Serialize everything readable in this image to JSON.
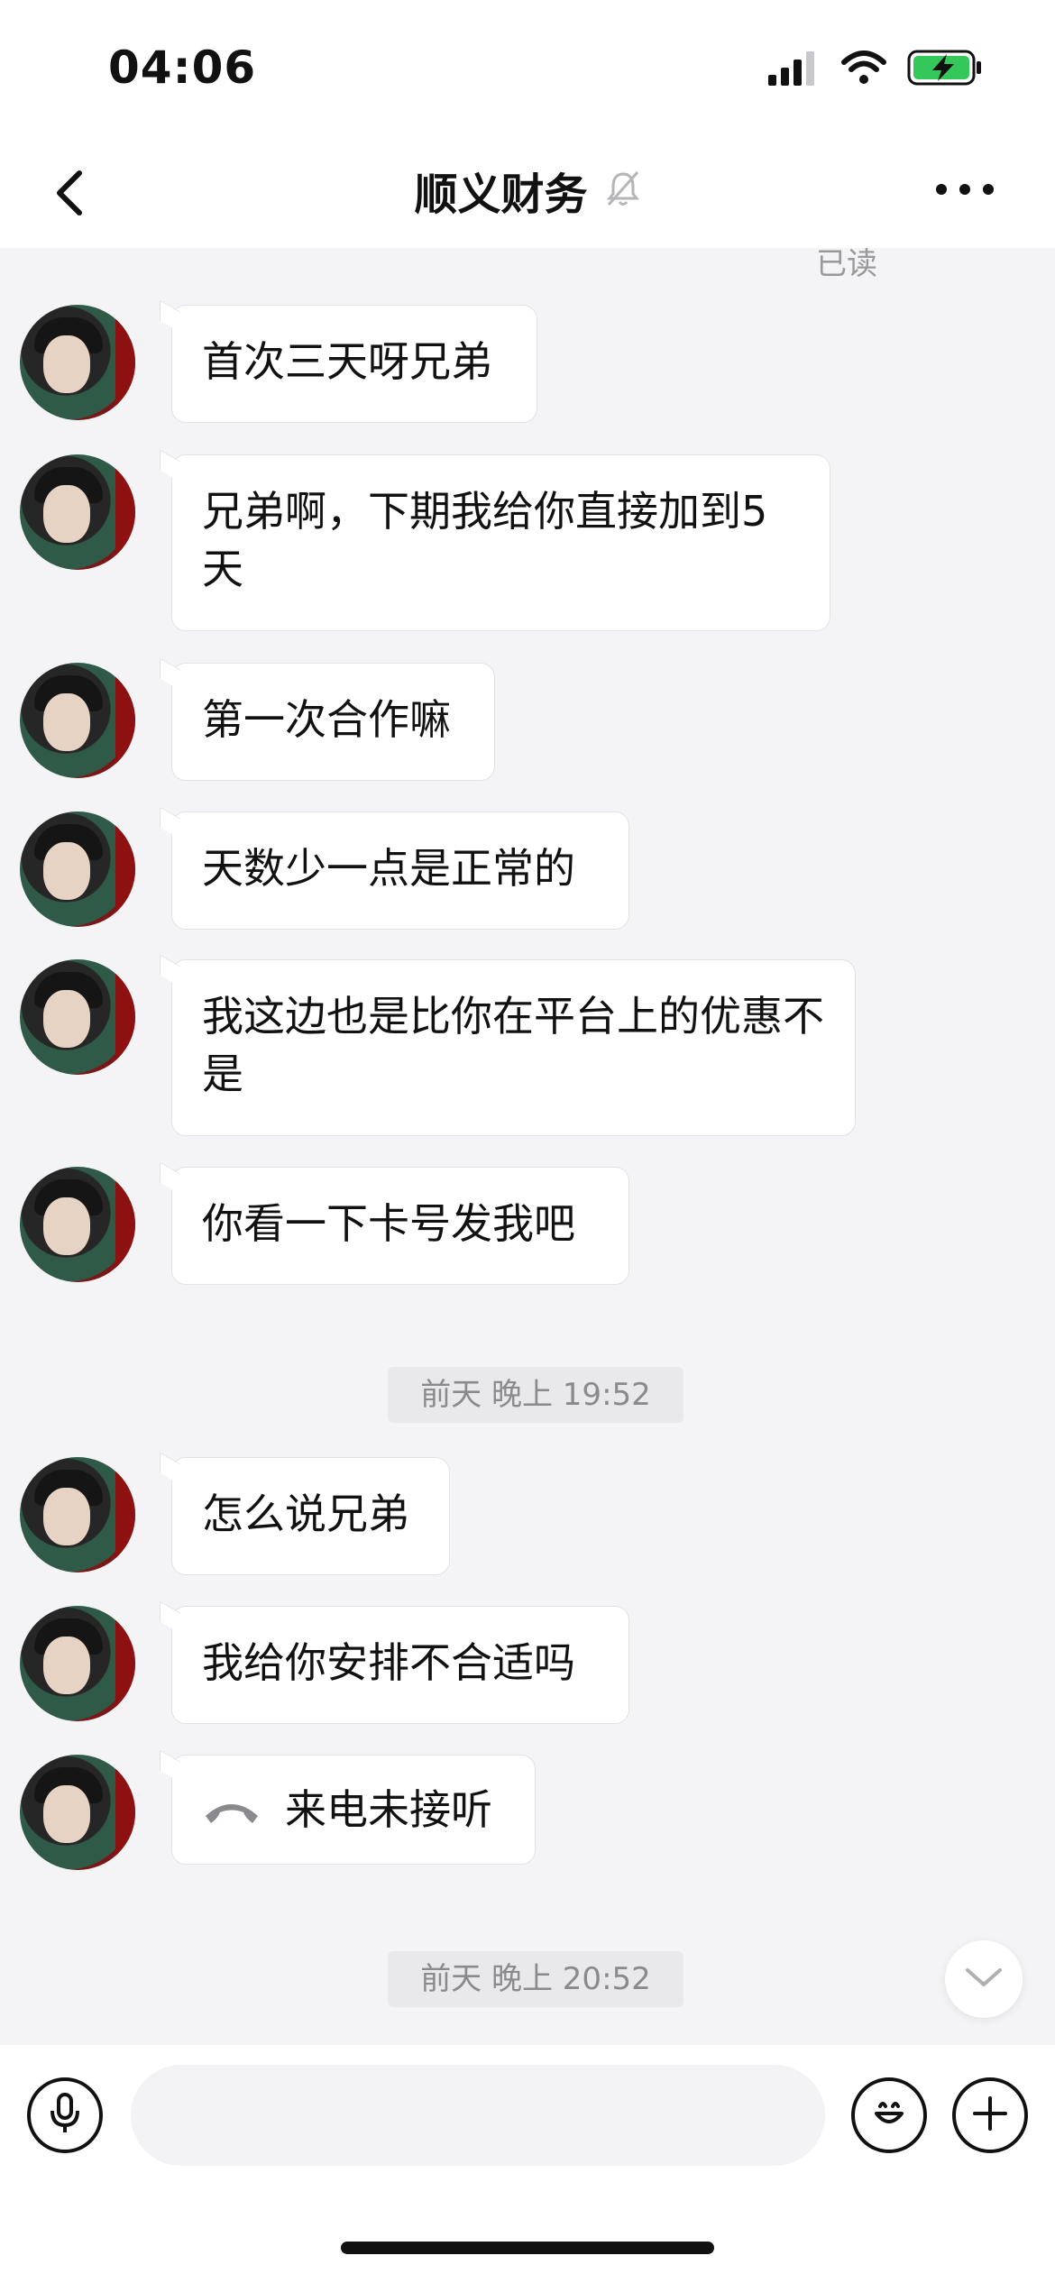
{
  "status_bar": {
    "time": "04:06",
    "icons": [
      "signal-icon",
      "wifi-icon",
      "battery-charging-icon"
    ],
    "battery_color": "#34c759"
  },
  "header": {
    "title": "顺义财务",
    "icons": [
      "back-icon",
      "muted-bell-icon",
      "more-icon"
    ]
  },
  "read_receipt": "已读",
  "messages": [
    {
      "text": "首次三天呀兄弟"
    },
    {
      "text": "兄弟啊，下期我给你直接加到5天"
    },
    {
      "text": "第一次合作嘛"
    },
    {
      "text": "天数少一点是正常的"
    },
    {
      "text": "我这边也是比你在平台上的优惠不是"
    },
    {
      "text": "你看一下卡号发我吧"
    },
    {
      "text": "怎么说兄弟"
    },
    {
      "text": "我给你安排不合适吗"
    },
    {
      "text": "来电未接听",
      "icon": "missed-call-icon"
    }
  ],
  "timestamps": [
    "前天 晚上 19:52",
    "前天 晚上 20:52"
  ],
  "input_bar": {
    "placeholder": "",
    "icons": [
      "microphone-icon",
      "emoji-icon",
      "plus-icon"
    ]
  },
  "scroll_down_icon": "chevron-down-icon"
}
